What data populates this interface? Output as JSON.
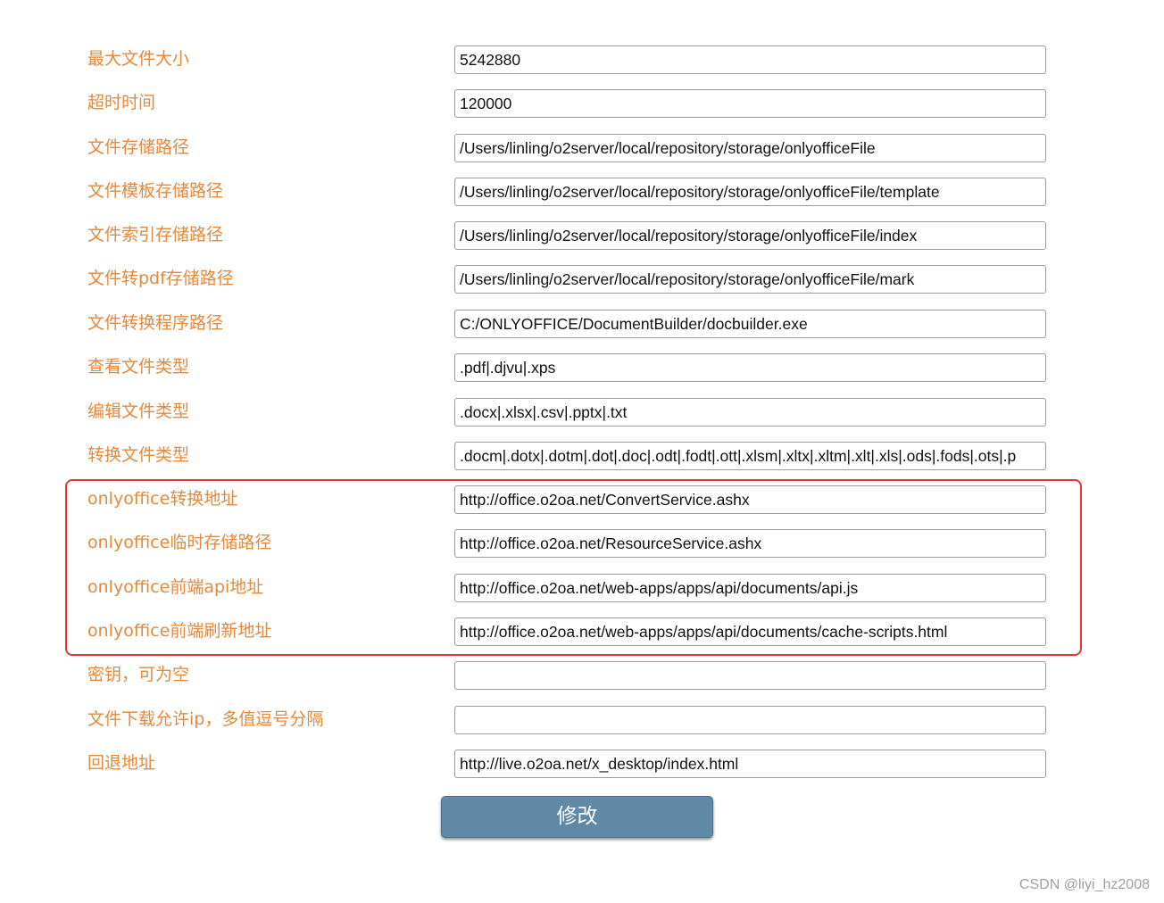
{
  "form": {
    "rows": [
      {
        "label": "最大文件大小",
        "value": "5242880"
      },
      {
        "label": "超时时间",
        "value": "120000"
      },
      {
        "label": "文件存储路径",
        "value": "/Users/linling/o2server/local/repository/storage/onlyofficeFile"
      },
      {
        "label": "文件模板存储路径",
        "value": "/Users/linling/o2server/local/repository/storage/onlyofficeFile/template"
      },
      {
        "label": "文件索引存储路径",
        "value": "/Users/linling/o2server/local/repository/storage/onlyofficeFile/index"
      },
      {
        "label": "文件转pdf存储路径",
        "value": "/Users/linling/o2server/local/repository/storage/onlyofficeFile/mark"
      },
      {
        "label": "文件转换程序路径",
        "value": "C:/ONLYOFFICE/DocumentBuilder/docbuilder.exe"
      },
      {
        "label": "查看文件类型",
        "value": ".pdf|.djvu|.xps"
      },
      {
        "label": "编辑文件类型",
        "value": ".docx|.xlsx|.csv|.pptx|.txt"
      },
      {
        "label": "转换文件类型",
        "value": ".docm|.dotx|.dotm|.dot|.doc|.odt|.fodt|.ott|.xlsm|.xltx|.xltm|.xlt|.xls|.ods|.fods|.ots|.p"
      },
      {
        "label": "onlyoffice转换地址",
        "value": "http://office.o2oa.net/ConvertService.ashx"
      },
      {
        "label": "onlyoffice临时存储路径",
        "value": "http://office.o2oa.net/ResourceService.ashx"
      },
      {
        "label": "onlyoffice前端api地址",
        "value": "http://office.o2oa.net/web-apps/apps/api/documents/api.js"
      },
      {
        "label": "onlyoffice前端刷新地址",
        "value": "http://office.o2oa.net/web-apps/apps/api/documents/cache-scripts.html"
      },
      {
        "label": "密钥，可为空",
        "value": ""
      },
      {
        "label": "文件下载允许ip，多值逗号分隔",
        "value": ""
      },
      {
        "label": "回退地址",
        "value": "http://live.o2oa.net/x_desktop/index.html"
      }
    ],
    "submit_label": "修改"
  },
  "watermark": "CSDN @liyi_hz2008",
  "colors": {
    "label": "#e6893c",
    "highlight_border": "#e8363c",
    "button_bg": "#6089a6"
  }
}
